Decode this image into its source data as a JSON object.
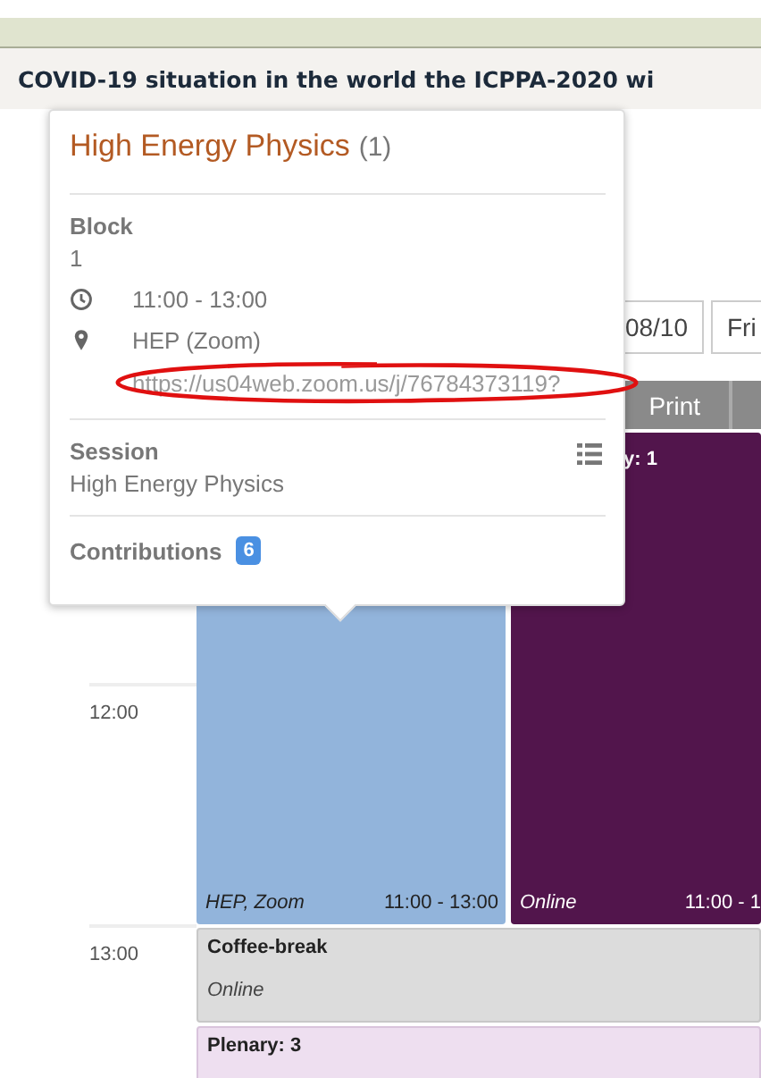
{
  "banner": {
    "text": "COVID-19 situation in the world the ICPPA-2020 wi"
  },
  "date_nav": {
    "buttons": [
      {
        "label": "08/10"
      },
      {
        "label": "Fri"
      }
    ]
  },
  "toolbar": {
    "print_label": "Print"
  },
  "calendar": {
    "time_labels": [
      "12:00",
      "13:00"
    ],
    "blocks": [
      {
        "location": "HEP, Zoom",
        "time": "11:00 - 13:00",
        "color": "#92b4db",
        "dark": false
      },
      {
        "title": "y: 1",
        "location": "Online",
        "time": "11:00 - 1",
        "color": "#52154c",
        "dark": true
      }
    ],
    "rows": [
      {
        "title": "Coffee-break",
        "location": "Online",
        "color": "#dcdcdc"
      },
      {
        "title": "Plenary: 3",
        "color": "#eedff0"
      }
    ]
  },
  "popup": {
    "title": "High Energy Physics",
    "count": "(1)",
    "block_label": "Block",
    "block_value": "1",
    "time": "11:00 - 13:00",
    "location": "HEP (Zoom)",
    "url": "https://us04web.zoom.us/j/76784373119?",
    "session_label": "Session",
    "session_value": "High Energy Physics",
    "contributions_label": "Contributions",
    "contributions_count": "6"
  }
}
